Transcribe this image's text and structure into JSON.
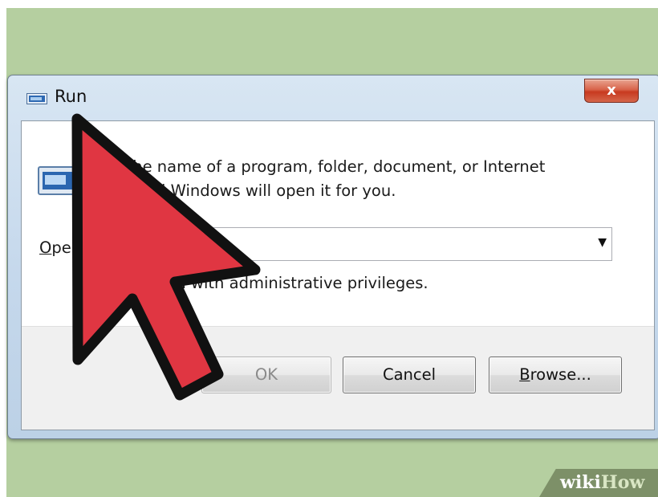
{
  "window": {
    "title": "Run",
    "close_label": "x"
  },
  "description": "Type the name of a program, folder, document, or Internet resource, and Windows will open it for you.",
  "description_lines": [
    "pe the name of a program, folder, document, or Internet",
    "rce, and Windows will open it for you."
  ],
  "open": {
    "label_underlined": "O",
    "label_rest": "pe",
    "value": ""
  },
  "admin_note": "be created with administrative privileges.",
  "buttons": {
    "ok": "OK",
    "cancel": "Cancel",
    "browse_underlined": "B",
    "browse_rest": "rowse..."
  },
  "watermark": {
    "wiki": "wiki",
    "how": "How"
  },
  "colors": {
    "background": "#b5cfa0",
    "cursor_fill": "#e03642",
    "cursor_outline": "#111111",
    "close_button": "#c8391f"
  },
  "icons": {
    "title_icon": "run-icon",
    "dialog_icon": "run-icon",
    "dropdown": "chevron-down-icon",
    "overlay": "arrow-cursor-icon"
  }
}
